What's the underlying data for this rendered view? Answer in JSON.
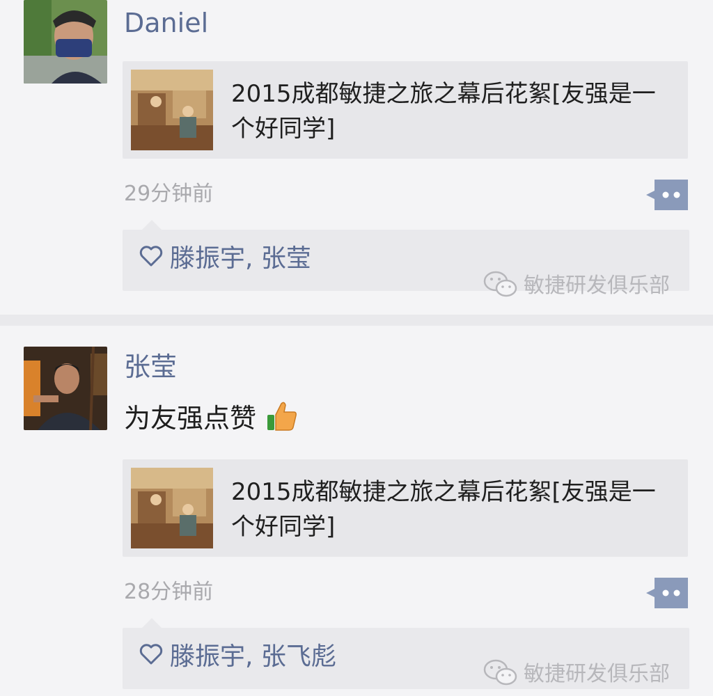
{
  "posts": [
    {
      "author": "Daniel",
      "caption": "",
      "link_title": "2015成都敏捷之旅之幕后花絮[友强是一个好同学]",
      "time": "29分钟前",
      "likes": "滕振宇, 张莹",
      "watermark": "敏捷研发俱乐部"
    },
    {
      "author": "张莹",
      "caption": "为友强点赞",
      "link_title": "2015成都敏捷之旅之幕后花絮[友强是一个好同学]",
      "time": "28分钟前",
      "likes": "滕振宇, 张飞彪",
      "watermark": "敏捷研发俱乐部"
    }
  ],
  "colors": {
    "name_link": "#5b6c93",
    "comment_button": "#8a9aba",
    "timestamp": "#a9a9ad",
    "card_background": "#e7e7ea"
  },
  "icons": {
    "comment": "comment-bubble-icon",
    "like": "heart-outline-icon",
    "thumbs_up": "thumbs-up-emoji-icon",
    "watermark": "wechat-logo-icon"
  }
}
